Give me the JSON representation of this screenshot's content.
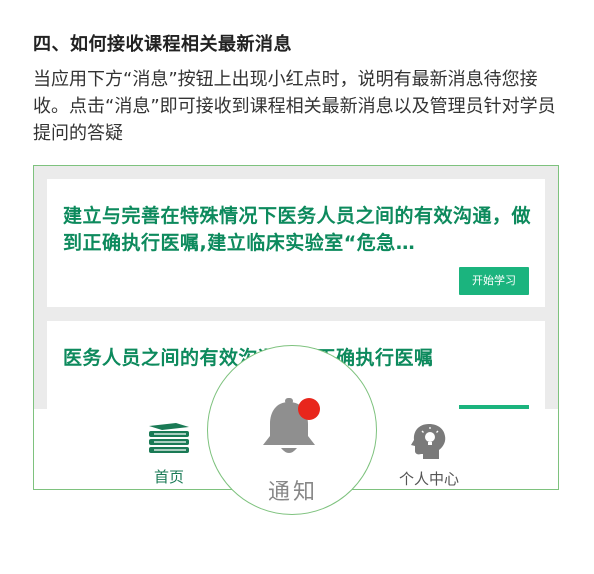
{
  "heading": "四、如何接收课程相关最新消息",
  "description": "当应用下方“消息”按钮上出现小红点时，说明有最新消息待您接收。点击“消息”即可接收到课程相关最新消息以及管理员针对学员提问的答疑",
  "cards": [
    {
      "title": "建立与完善在特殊情况下医务人员之间的有效沟通，做到正确执行医嘱,建立临床实验室“危急…",
      "button": "开始学习"
    },
    {
      "title": "医务人员之间的有效沟通做到正确执行医嘱"
    }
  ],
  "tabs": {
    "home": "首页",
    "message": "通知",
    "profile": "个人中心"
  },
  "colors": {
    "accent": "#1bb47e",
    "title_green": "#0d8a5d",
    "badge_red": "#e8261c",
    "frame_border": "#7ec27e"
  },
  "icons": [
    "books-icon",
    "bell-icon",
    "head-lightbulb-icon"
  ]
}
